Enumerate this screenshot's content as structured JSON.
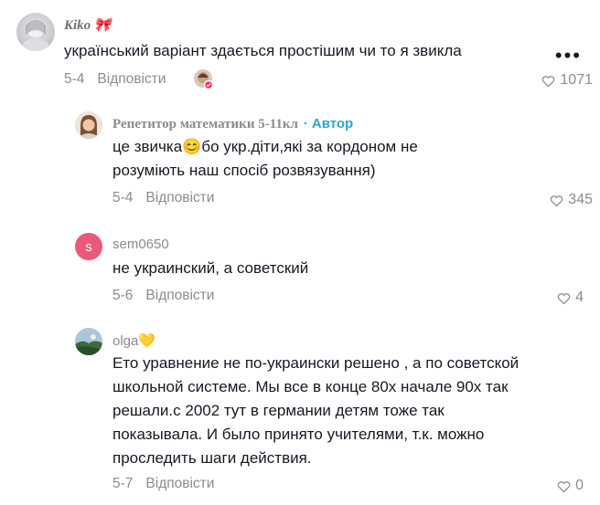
{
  "comments": [
    {
      "name": "Kiko 🎀",
      "text": "український варіант здається простішим чи то я звикла",
      "date": "5-4",
      "reply": "Відповісти",
      "likes": "1071"
    },
    {
      "name": "Репетитор математики 5-11кл",
      "author_badge": "· Автор",
      "text": "це звичка😊бо укр.діти,які за кордоном не розуміють наш спосіб розвязування)",
      "date": "5-4",
      "reply": "Відповісти",
      "likes": "345"
    },
    {
      "name": "sem0650",
      "avatar_letter": "S",
      "text": "не украинский, а советский",
      "date": "5-6",
      "reply": "Відповісти",
      "likes": "4"
    },
    {
      "name": "olga💛",
      "text": "Ето уравнение не по-украински решено , а по советской школьной системе. Мы все в конце 80х начале 90х так решали.с 2002 тут в германии детям тоже так показывала. И было принято учителями, т.к. можно проследить шаги действия.",
      "date": "5-7",
      "reply": "Відповісти",
      "likes": "0"
    }
  ],
  "more_icon": "more-dots-icon",
  "like_icon": "heart-outline-icon",
  "colors": {
    "muted": "#8a8b91",
    "text": "#161823",
    "author": "#2fa3d1",
    "avatar_s": "#e9597a"
  }
}
